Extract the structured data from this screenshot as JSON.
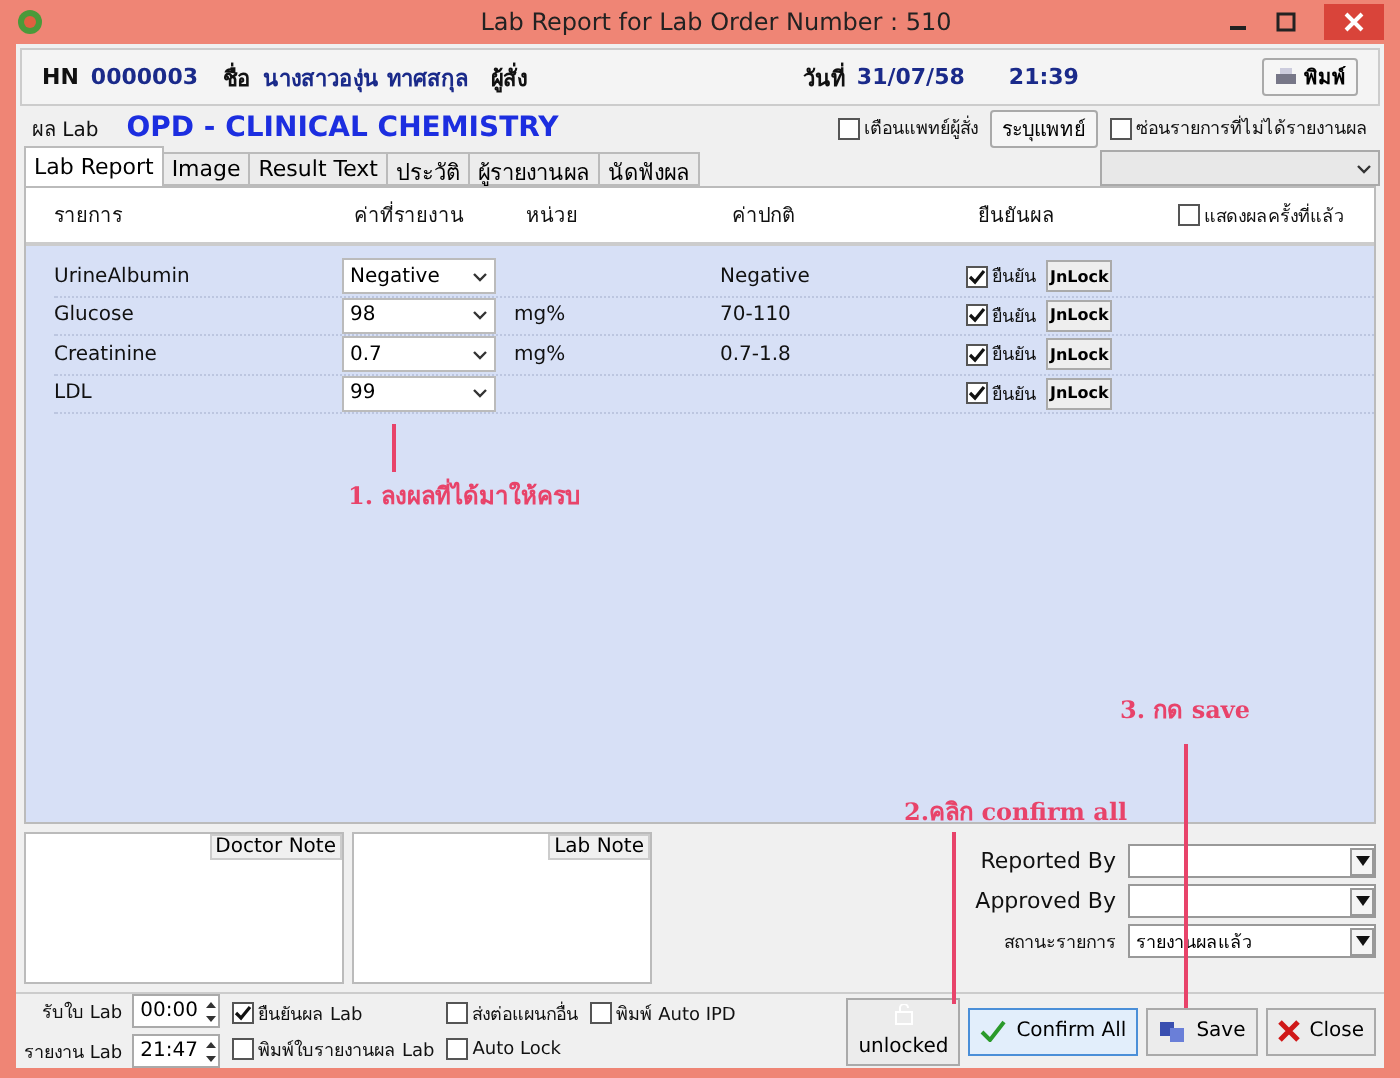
{
  "window": {
    "title": "Lab Report for Lab Order Number : 510"
  },
  "header": {
    "hn_label": "HN",
    "hn": "0000003",
    "name_label": "ชื่อ",
    "name": "นางสาวองุ่น ทาศสกุล",
    "orderer_label": "ผู้สั่ง",
    "date_label": "วันที่",
    "date": "31/07/58",
    "time": "21:39",
    "print_button": "พิมพ์"
  },
  "lab": {
    "label": "ผล Lab",
    "section": "OPD - CLINICAL CHEMISTRY",
    "options": [
      {
        "kind": "checkbox",
        "label": "เตือนแพทย์ผู้สั่ง",
        "checked": false
      },
      {
        "kind": "button",
        "label": "ระบุแพทย์"
      },
      {
        "kind": "checkbox",
        "label": "ซ่อนรายการที่ไม่ได้รายงานผล",
        "checked": false
      }
    ]
  },
  "tabs": [
    {
      "label": "Lab Report",
      "selected": true
    },
    {
      "label": "Image",
      "selected": false
    },
    {
      "label": "Result Text",
      "selected": false
    },
    {
      "label": "ประวัติ",
      "selected": false
    },
    {
      "label": "ผู้รายงานผล",
      "selected": false
    },
    {
      "label": "นัดฟังผล",
      "selected": false
    }
  ],
  "table": {
    "columns": [
      "รายการ",
      "ค่าที่รายงาน",
      "หน่วย",
      "ค่าปกติ",
      "ยืนยันผล"
    ],
    "show_previous": {
      "label": "แสดงผลครั้งที่แล้ว",
      "checked": false
    },
    "rows": [
      {
        "name": "UrineAlbumin",
        "value": "Negative",
        "unit": "",
        "normal": "Negative",
        "confirm_label": "ยืนยัน",
        "confirmed": true,
        "unlock": "JnLock"
      },
      {
        "name": "Glucose",
        "value": "98",
        "unit": "mg%",
        "normal": "70-110",
        "confirm_label": "ยืนยัน",
        "confirmed": true,
        "unlock": "JnLock"
      },
      {
        "name": "Creatinine",
        "value": "0.7",
        "unit": "mg%",
        "normal": "0.7-1.8",
        "confirm_label": "ยืนยัน",
        "confirmed": true,
        "unlock": "JnLock"
      },
      {
        "name": "LDL",
        "value": "99",
        "unit": "",
        "normal": "",
        "confirm_label": "ยืนยัน",
        "confirmed": true,
        "unlock": "JnLock"
      }
    ]
  },
  "annotations": [
    "1.  ลงผลที่ได้มาให้ครบ",
    "3. กด  save",
    "2.คลิก confirm all"
  ],
  "notes": [
    "Doctor Note",
    "Lab Note"
  ],
  "fields": [
    {
      "label": "Reported By"
    },
    {
      "label": "Approved By"
    },
    {
      "label": "สถานะรายการ",
      "value": "รายงานผลแล้ว"
    }
  ],
  "times": [
    {
      "label": "รับใบ Lab",
      "value": "00:00"
    },
    {
      "label": "รายงาน Lab",
      "value": "21:47"
    }
  ],
  "options": [
    {
      "label": "ยืนยันผล Lab",
      "checked": true
    },
    {
      "label": "ส่งต่อแผนกอื่น",
      "checked": false
    },
    {
      "label": "พิมพ์  Auto IPD",
      "checked": false
    },
    {
      "label": "พิมพ์ใบรายงานผล Lab",
      "checked": false
    },
    {
      "label": "Auto Lock",
      "checked": false
    }
  ],
  "buttons": [
    {
      "kind": "unlock",
      "label": "unlocked"
    },
    {
      "kind": "confirm",
      "label": "Confirm All"
    },
    {
      "kind": "save",
      "label": "Save"
    },
    {
      "kind": "close",
      "label": "Close"
    }
  ]
}
